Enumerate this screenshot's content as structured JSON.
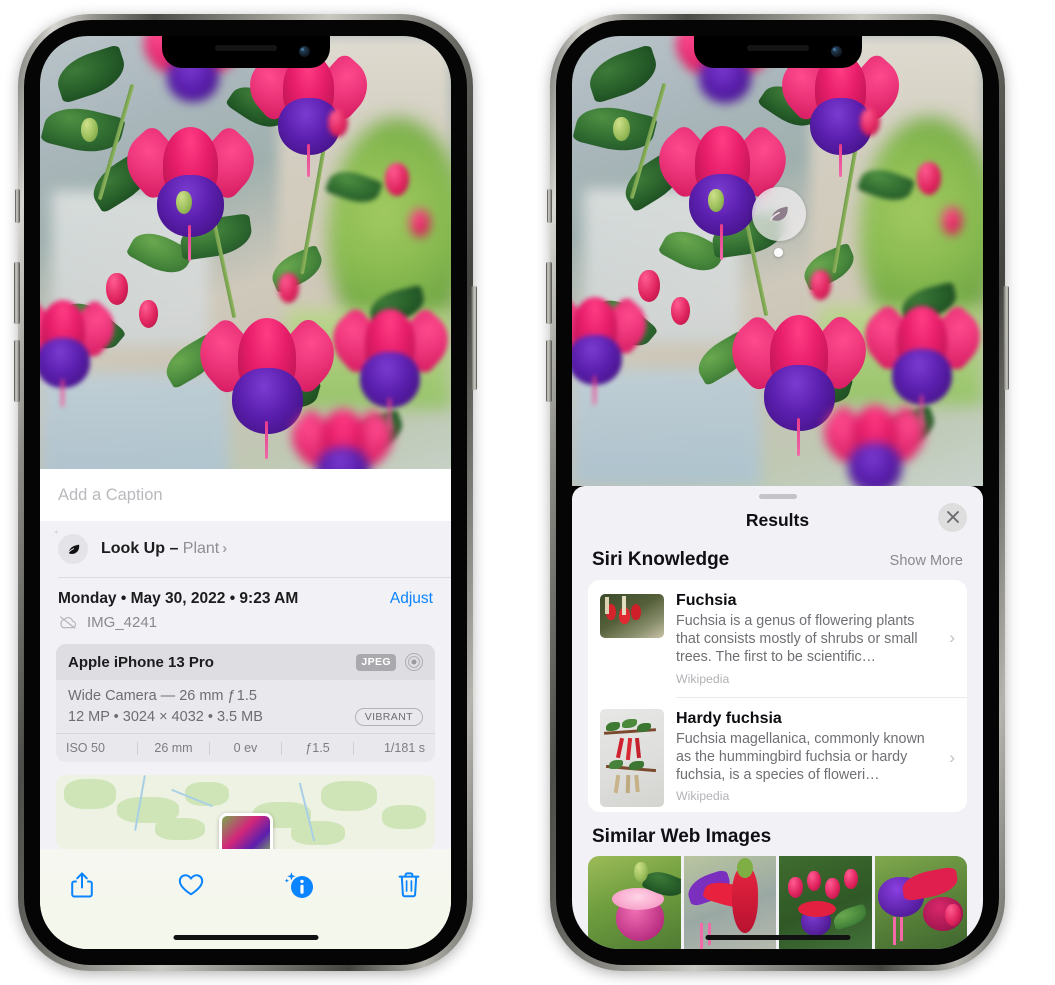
{
  "device": {
    "model_icons": {
      "mute_switch": "mute-switch",
      "volume_up": "volume-up-button",
      "volume_down": "volume-down-button",
      "power": "power-button",
      "camera": "front-camera",
      "speaker": "earpiece-speaker"
    }
  },
  "left_phone": {
    "photo": {
      "subject": "fuchsia-flowers-photo",
      "alt": "Hanging fuchsia plant with pink and purple flowers"
    },
    "caption": {
      "placeholder": "Add a Caption",
      "value": ""
    },
    "lookup": {
      "icon": "leaf-icon",
      "sparkle_icon": "sparkles-icon",
      "label": "Look Up – ",
      "subject": "Plant",
      "chevron": "›"
    },
    "meta": {
      "date": "Monday • May 30, 2022 • 9:23 AM",
      "adjust_label": "Adjust",
      "cloud_icon": "cloud-slash-icon",
      "filename": "IMG_4241"
    },
    "exif": {
      "device": "Apple iPhone 13 Pro",
      "format_badge": "JPEG",
      "aperture_icon": "aperture-icon",
      "lens_line": "Wide Camera — 26 mm ƒ 1.5",
      "size_line": "12 MP • 3024 × 4032 • 3.5 MB",
      "style_badge": "VIBRANT",
      "stats": [
        "ISO 50",
        "26 mm",
        "0 ev",
        "ƒ1.5",
        "1/181 s"
      ]
    },
    "map": {
      "name": "location-map-card",
      "pin": "photo-map-pin"
    },
    "toolbar": [
      {
        "name": "share-button",
        "icon": "share-icon"
      },
      {
        "name": "favorite-button",
        "icon": "heart-icon"
      },
      {
        "name": "info-button",
        "icon": "info-sparkle-icon"
      },
      {
        "name": "delete-button",
        "icon": "trash-icon"
      }
    ],
    "accent_color": "#0a84ff"
  },
  "right_phone": {
    "photo": {
      "subject": "fuchsia-flowers-photo",
      "badge_icon": "leaf-icon",
      "badge_label": "visual-look-up-badge"
    },
    "sheet": {
      "grabber": "sheet-grabber",
      "title": "Results",
      "close_icon": "close-icon"
    },
    "siri_knowledge": {
      "title": "Siri Knowledge",
      "action": "Show More",
      "entries": [
        {
          "title": "Fuchsia",
          "description": "Fuchsia is a genus of flowering plants that consists mostly of shrubs or small trees. The first to be scientific…",
          "source": "Wikipedia",
          "thumb": "fuchsia-red-flowers-thumbnail",
          "chevron": "›"
        },
        {
          "title": "Hardy fuchsia",
          "description": "Fuchsia magellanica, commonly known as the hummingbird fuchsia or hardy fuchsia, is a species of floweri…",
          "source": "Wikipedia",
          "thumb": "hardy-fuchsia-specimen-thumbnail",
          "chevron": "›"
        }
      ]
    },
    "similar_web_images": {
      "title": "Similar Web Images",
      "images": [
        {
          "name": "web-image-1",
          "alt": "Pink and magenta fuchsia with green leaves"
        },
        {
          "name": "web-image-2",
          "alt": "Red and purple fuchsia close up"
        },
        {
          "name": "web-image-3",
          "alt": "Fuchsia bush with buds"
        },
        {
          "name": "web-image-4",
          "alt": "Purple and red double fuchsia bloom"
        }
      ]
    }
  }
}
